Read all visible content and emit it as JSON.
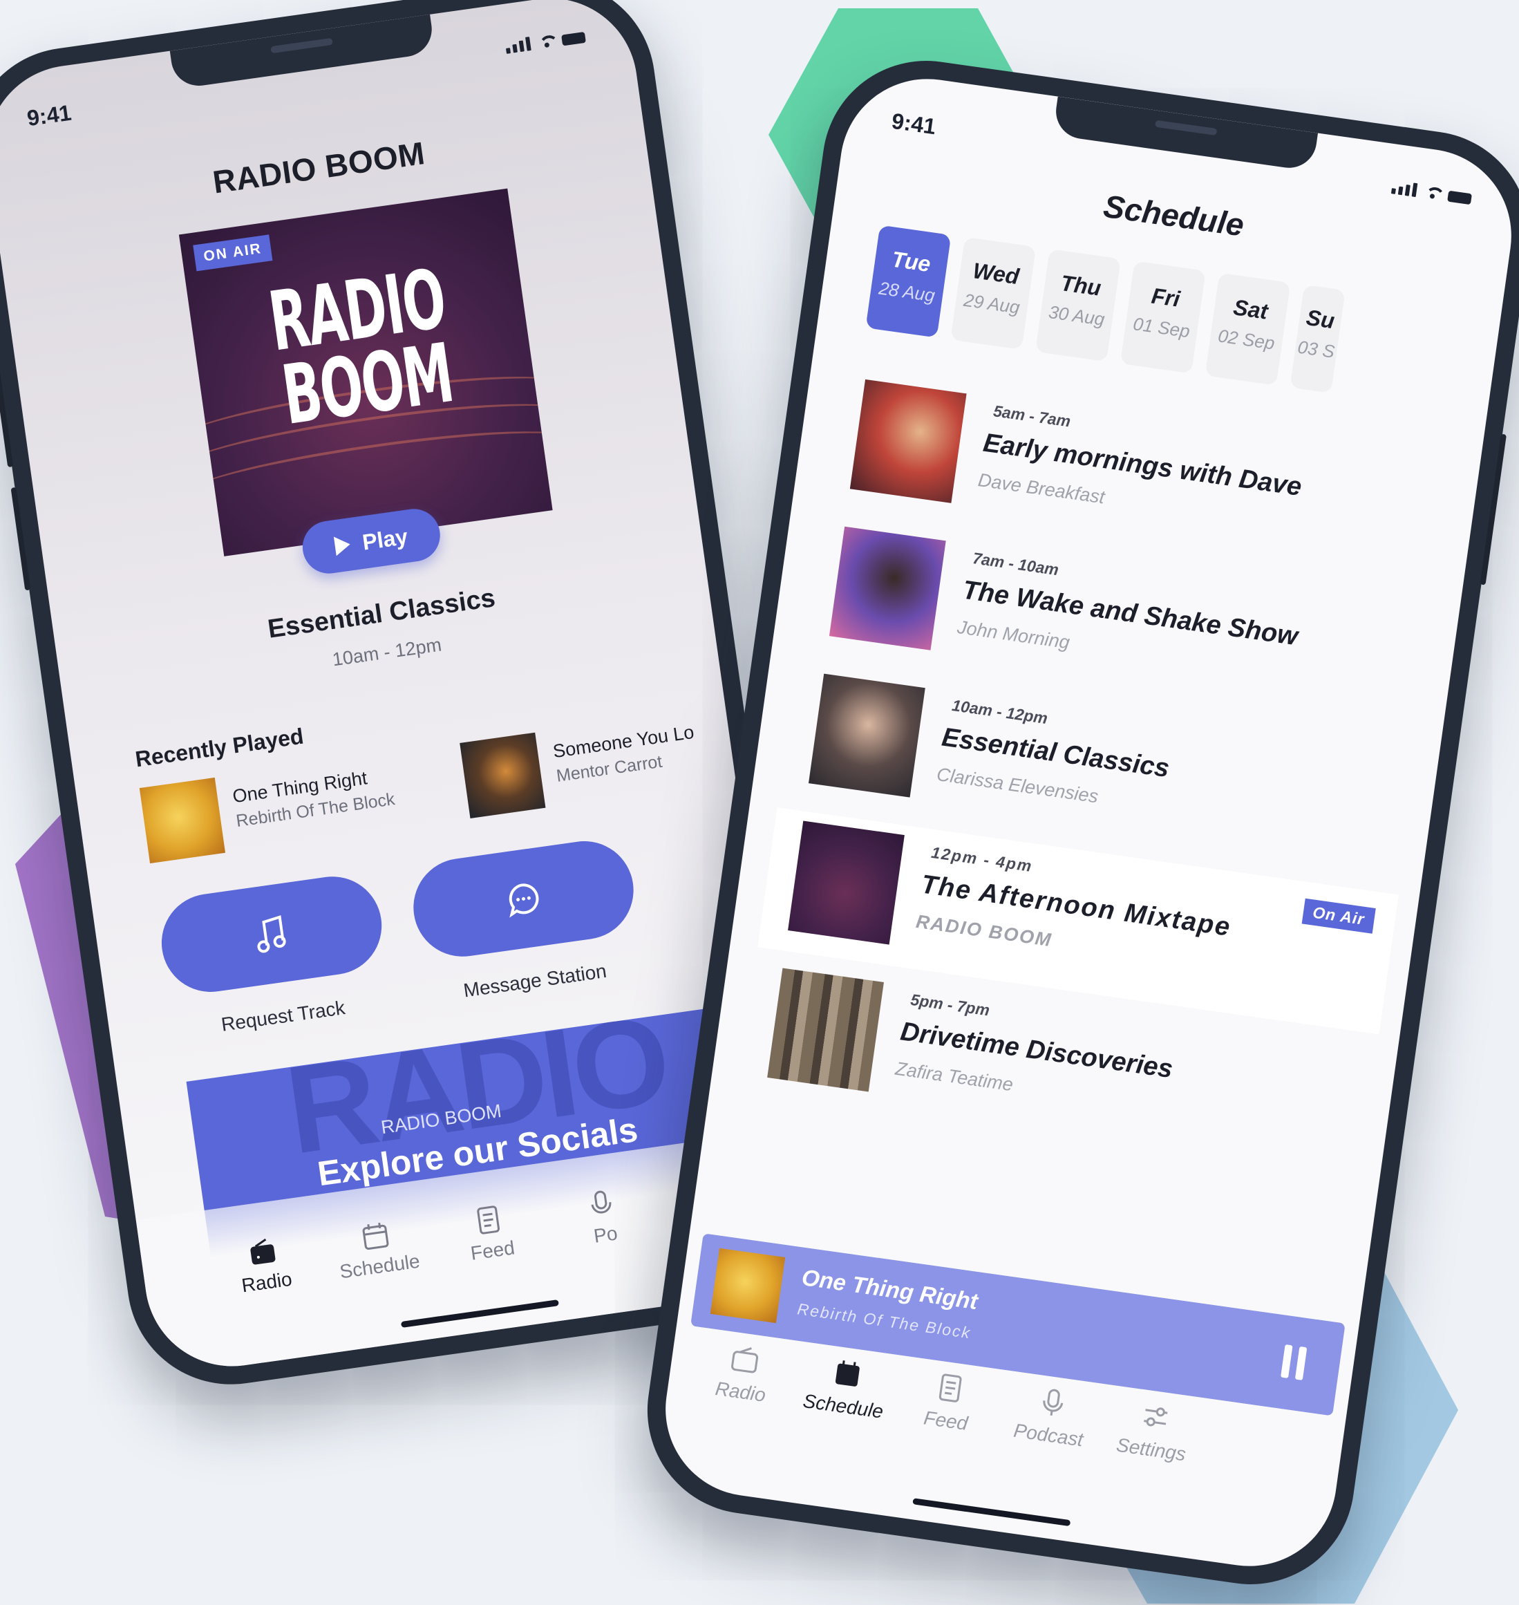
{
  "colors": {
    "accent": "#5a67d8",
    "hex_green": "#62d4a8",
    "hex_purple": "#a274c8",
    "hex_blue": "#a2c8e2",
    "phone_frame": "#262d3a"
  },
  "radio_screen": {
    "status_time": "9:41",
    "app_title": "RADIO BOOM",
    "cover": {
      "badge": "ON AIR",
      "title_line1": "RADIO",
      "title_line2": "BOOM"
    },
    "play_label": "Play",
    "now_show": {
      "title": "Essential Classics",
      "time": "10am - 12pm"
    },
    "recently_played": {
      "heading": "Recently Played",
      "items": [
        {
          "title": "One Thing Right",
          "artist": "Rebirth Of The Block"
        },
        {
          "title": "Someone You Lo",
          "artist": "Mentor Carrot"
        }
      ]
    },
    "actions": {
      "request_label": "Request Track",
      "message_label": "Message Station"
    },
    "socials": {
      "bg_text": "RADIO",
      "kicker": "RADIO BOOM",
      "title": "Explore our Socials"
    },
    "tabs": [
      "Radio",
      "Schedule",
      "Feed",
      "Po"
    ]
  },
  "schedule_screen": {
    "status_time": "9:41",
    "title": "Schedule",
    "days": [
      {
        "name": "Tue",
        "date": "28 Aug",
        "active": true
      },
      {
        "name": "Wed",
        "date": "29 Aug"
      },
      {
        "name": "Thu",
        "date": "30 Aug"
      },
      {
        "name": "Fri",
        "date": "01 Sep"
      },
      {
        "name": "Sat",
        "date": "02 Sep"
      },
      {
        "name": "Su",
        "date": "03 S"
      }
    ],
    "programmes": [
      {
        "time": "5am - 7am",
        "name": "Early mornings with Dave",
        "host": "Dave Breakfast"
      },
      {
        "time": "7am - 10am",
        "name": "The Wake and Shake Show",
        "host": "John Morning"
      },
      {
        "time": "10am - 12pm",
        "name": "Essential Classics",
        "host": "Clarissa Elevensies"
      },
      {
        "time": "12pm - 4pm",
        "name": "The Afternoon Mixtape",
        "host": "RADIO BOOM",
        "badge": "On Air"
      },
      {
        "time": "5pm - 7pm",
        "name": "Drivetime Discoveries",
        "host": "Zafira Teatime"
      }
    ],
    "mini_player": {
      "title": "One Thing Right",
      "artist": "Rebirth Of The Block"
    },
    "tabs": [
      "Radio",
      "Schedule",
      "Feed",
      "Podcast",
      "Settings"
    ],
    "active_tab": "Schedule"
  }
}
